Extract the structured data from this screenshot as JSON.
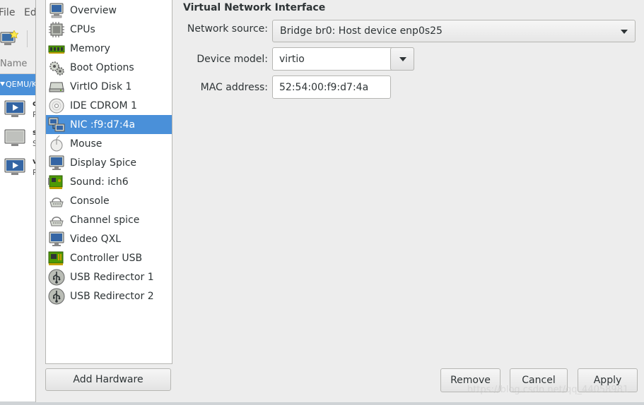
{
  "background": {
    "menu": [
      "File",
      "Ed"
    ],
    "column_header": "Name",
    "selected_host": "QEMU/K",
    "vms": [
      {
        "line1": "c",
        "line2": "R"
      },
      {
        "line1": "s",
        "line2": "S"
      },
      {
        "line1": "v",
        "line2": "R"
      }
    ]
  },
  "dialog": {
    "hardware_list": [
      {
        "label": "Overview",
        "icon": "monitor-icon"
      },
      {
        "label": "CPUs",
        "icon": "cpu-icon"
      },
      {
        "label": "Memory",
        "icon": "memory-icon"
      },
      {
        "label": "Boot Options",
        "icon": "gears-icon"
      },
      {
        "label": "VirtIO Disk 1",
        "icon": "disk-icon"
      },
      {
        "label": "IDE CDROM 1",
        "icon": "cdrom-icon"
      },
      {
        "label": "NIC :f9:d7:4a",
        "icon": "network-icon",
        "selected": true
      },
      {
        "label": "Mouse",
        "icon": "mouse-icon"
      },
      {
        "label": "Display Spice",
        "icon": "display-icon"
      },
      {
        "label": "Sound: ich6",
        "icon": "sound-card-icon"
      },
      {
        "label": "Console",
        "icon": "serial-icon"
      },
      {
        "label": "Channel spice",
        "icon": "serial-icon"
      },
      {
        "label": "Video QXL",
        "icon": "display-icon"
      },
      {
        "label": "Controller USB",
        "icon": "controller-icon"
      },
      {
        "label": "USB Redirector 1",
        "icon": "usb-icon"
      },
      {
        "label": "USB Redirector 2",
        "icon": "usb-icon"
      }
    ],
    "add_hardware": "Add Hardware",
    "section_title": "Virtual Network Interface",
    "fields": {
      "network_source_label": "Network source:",
      "network_source_value": "Bridge br0: Host device enp0s25",
      "device_model_label": "Device model:",
      "device_model_value": "virtio",
      "mac_label": "MAC address:",
      "mac_value": "52:54:00:f9:d7:4a"
    },
    "buttons": {
      "remove": "Remove",
      "cancel": "Cancel",
      "apply": "Apply"
    },
    "watermark": "https://blog.csdn.net/qq_44058981"
  },
  "colors": {
    "selection": "#4a90d9",
    "window_bg": "#ededed"
  }
}
